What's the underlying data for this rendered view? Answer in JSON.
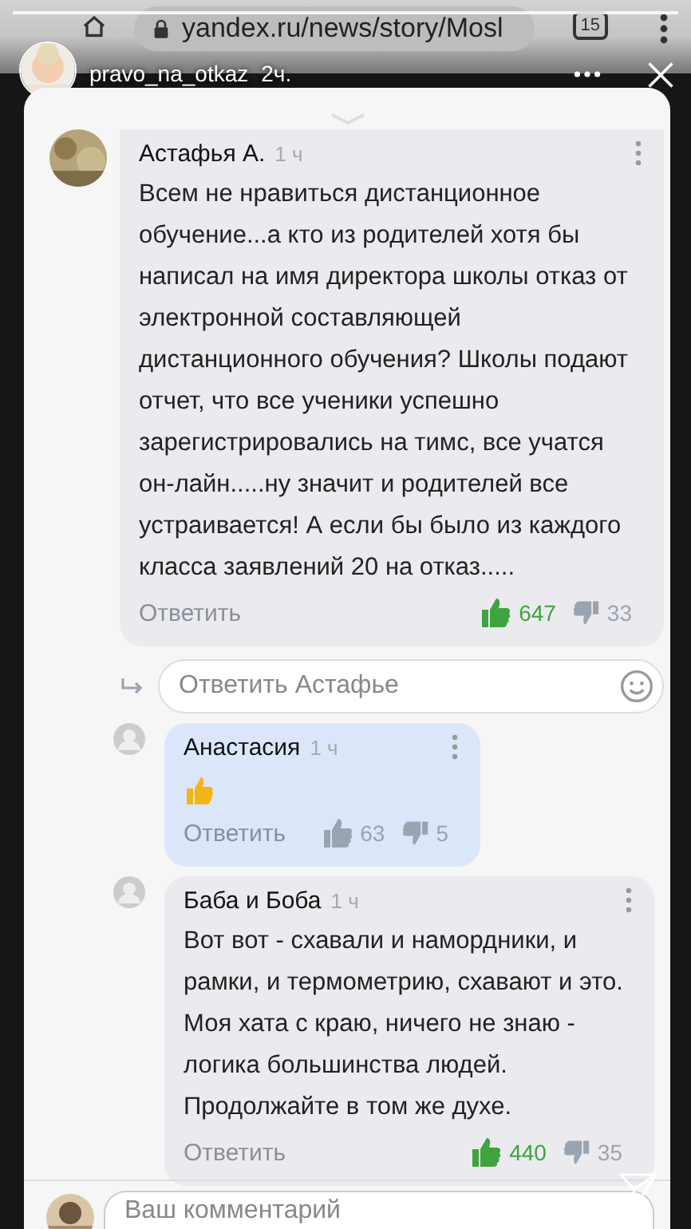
{
  "browser": {
    "url": "yandex.ru/news/story/Mosl",
    "tab_count": "15"
  },
  "story": {
    "username": "pravo_na_otkaz",
    "time": "2ч."
  },
  "comments": [
    {
      "kind": "comment",
      "highlighted": false,
      "author": "Астафья А.",
      "time": "1 ч",
      "text": "Всем не нравиться дистанционное обучение...а кто из родителей хотя бы написал на имя директора школы отказ от электронной составляющей дистанционного обучения? Школы подают отчет, что все ученики успешно зарегистрировались на тимс, все учатся он-лайн.....ну значит и родителей все устраивается! А если бы было из каждого класса заявлений 20 на отказ.....",
      "reply": "Ответить",
      "likes": "647",
      "dislikes": "33",
      "liked": true,
      "reply_field": {
        "placeholder": "Ответить Астафье"
      }
    },
    {
      "kind": "emoji_reply",
      "highlighted": true,
      "author": "Анастасия",
      "time": "1 ч",
      "reply": "Ответить",
      "likes": "63",
      "dislikes": "5",
      "liked": false
    },
    {
      "kind": "reply",
      "highlighted": false,
      "author": "Баба и Боба",
      "time": "1 ч",
      "text": "Вот вот - схавали и намордники, и рамки, и термометрию, схавают и это. Моя хата с краю, ничего не знаю - логика большинства людей. Продолжайте в том же духе.",
      "reply": "Ответить",
      "likes": "440",
      "dislikes": "35",
      "liked": true
    }
  ],
  "comment_field": {
    "placeholder": "Ваш комментарий"
  }
}
